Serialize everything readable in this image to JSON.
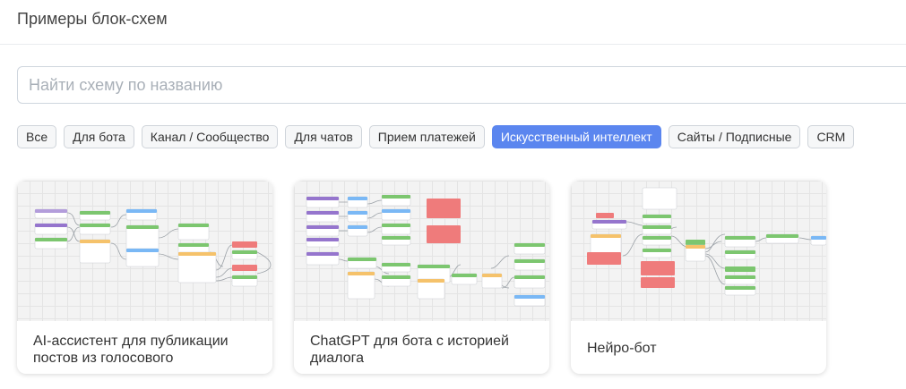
{
  "header": {
    "title": "Примеры блок-схем"
  },
  "search": {
    "placeholder": "Найти схему по названию",
    "value": ""
  },
  "filters": [
    {
      "label": "Все",
      "active": false
    },
    {
      "label": "Для бота",
      "active": false
    },
    {
      "label": "Канал / Сообщество",
      "active": false
    },
    {
      "label": "Для чатов",
      "active": false
    },
    {
      "label": "Прием платежей",
      "active": false
    },
    {
      "label": "Искусственный интеллект",
      "active": true
    },
    {
      "label": "Сайты / Подписные",
      "active": false
    },
    {
      "label": "CRM",
      "active": false
    }
  ],
  "colors": {
    "accent": "#5b86ef"
  },
  "cards": [
    {
      "title": "AI-ассистент для публикации постов из голосового"
    },
    {
      "title": "ChatGPT для бота с историей диалога"
    },
    {
      "title": "Нейро-бот"
    }
  ]
}
